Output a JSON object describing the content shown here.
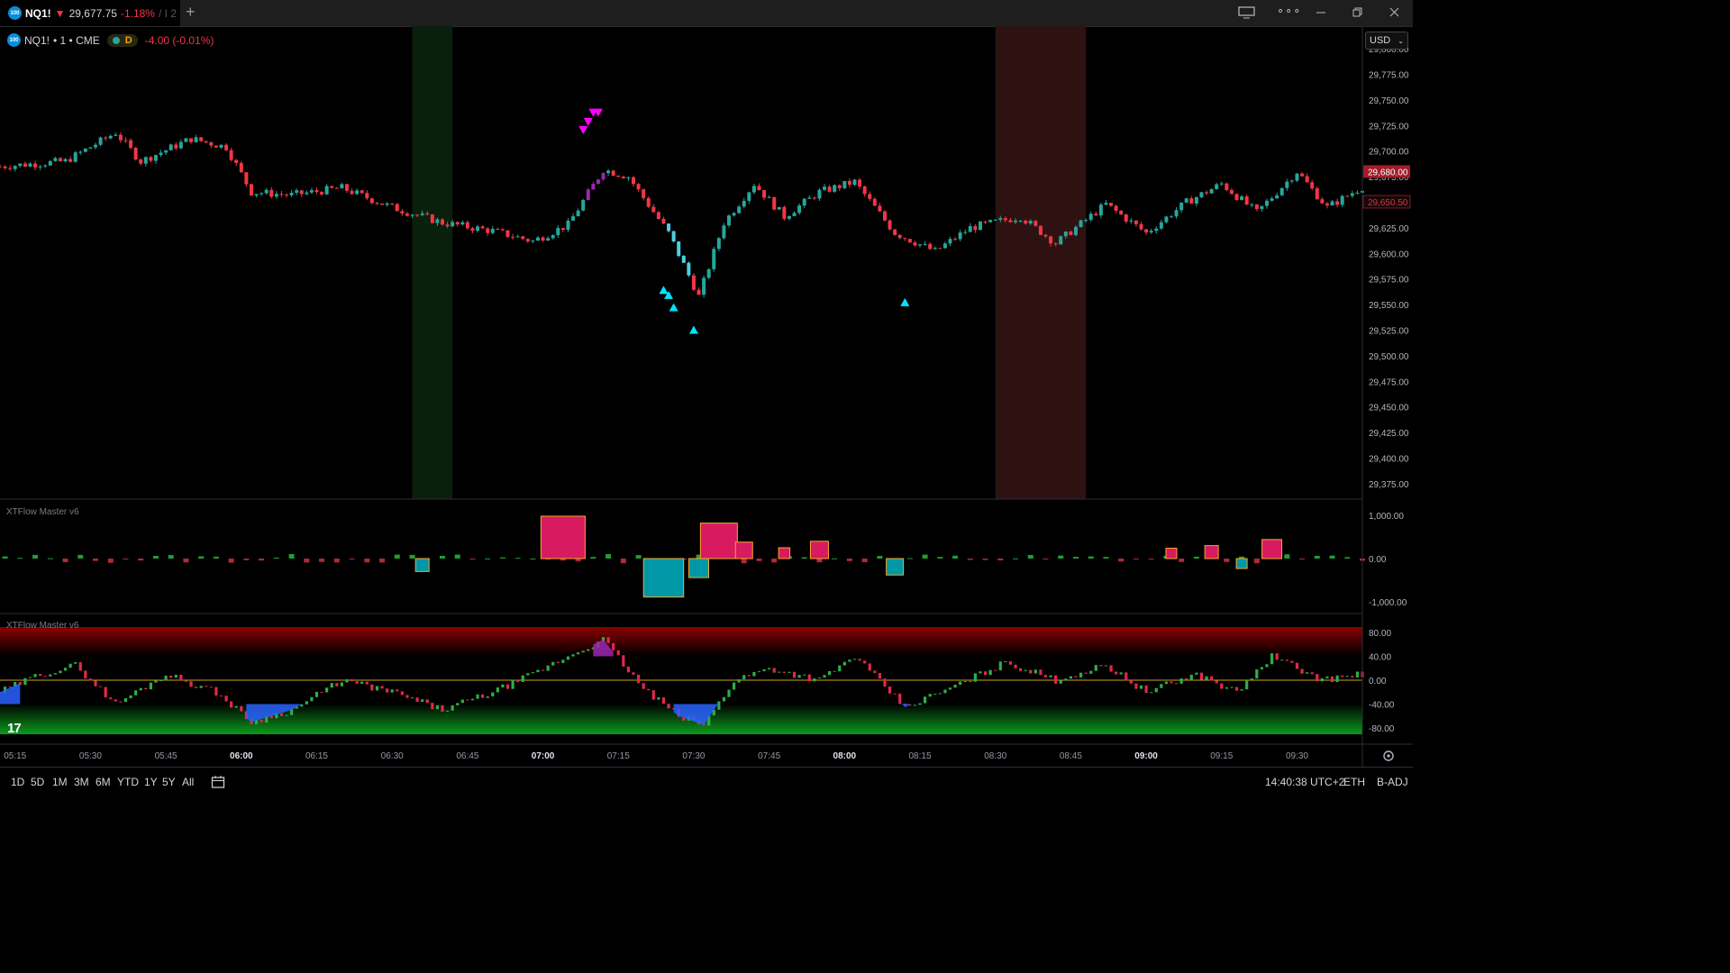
{
  "tab": {
    "symbol": "NQ1!",
    "arrow": "▼",
    "price": "29,677.75",
    "change": "-1.18%",
    "extra": "/ I 2"
  },
  "legend": {
    "symbol": "NQ1!",
    "interval": "• 1 • CME",
    "pill": "D",
    "change": "-4.00 (-0.01%)"
  },
  "currency": "USD",
  "logo_text": "100",
  "icons": [
    "monitor-icon",
    "more-icon",
    "minimize-icon",
    "maximize-icon",
    "close-icon",
    "calendar-icon",
    "settings-icon"
  ],
  "colors": {
    "up": "#26a69a",
    "down": "#f23645",
    "accent": "#d81b60",
    "cyan": "#00bcd4"
  },
  "price_axis": {
    "ticks": [
      "29,800.00",
      "29,775.00",
      "29,750.00",
      "29,725.00",
      "29,700.00",
      "29,675.00",
      "29,650.00",
      "29,625.00",
      "29,600.00",
      "29,575.00",
      "29,550.00",
      "29,525.00",
      "29,500.00",
      "29,475.00",
      "29,450.00",
      "29,425.00",
      "29,400.00",
      "29,375.00"
    ],
    "current_label": "29,680.00",
    "secondary_label": "29,650.50"
  },
  "panes": {
    "hist_label": "XTFlow Master v6",
    "hist_ticks": [
      "1,000.00",
      "0.00",
      "-1,000.00"
    ],
    "osc_label": "XTFlow Master v6",
    "osc_ticks": [
      "80.00",
      "40.00",
      "0.00",
      "-40.00",
      "-80.00"
    ]
  },
  "time_axis": [
    {
      "label": "05:15",
      "bold": false
    },
    {
      "label": "05:30",
      "bold": false
    },
    {
      "label": "05:45",
      "bold": false
    },
    {
      "label": "06:00",
      "bold": true
    },
    {
      "label": "06:15",
      "bold": false
    },
    {
      "label": "06:30",
      "bold": false
    },
    {
      "label": "06:45",
      "bold": false
    },
    {
      "label": "07:00",
      "bold": true
    },
    {
      "label": "07:15",
      "bold": false
    },
    {
      "label": "07:30",
      "bold": false
    },
    {
      "label": "07:45",
      "bold": false
    },
    {
      "label": "08:00",
      "bold": true
    },
    {
      "label": "08:15",
      "bold": false
    },
    {
      "label": "08:30",
      "bold": false
    },
    {
      "label": "08:45",
      "bold": false
    },
    {
      "label": "09:00",
      "bold": true
    },
    {
      "label": "09:15",
      "bold": false
    },
    {
      "label": "09:30",
      "bold": false
    }
  ],
  "ranges": [
    "1D",
    "5D",
    "1M",
    "3M",
    "6M",
    "YTD",
    "1Y",
    "5Y",
    "All"
  ],
  "status": {
    "clock": "14:40:38 UTC+2",
    "session": "ETH",
    "adj": "B-ADJ"
  },
  "chart_data": {
    "type": "candlestick",
    "x_range": [
      "05:12",
      "09:43"
    ],
    "y_range": [
      29360,
      29815
    ],
    "price_path": [
      [
        "05:12",
        29685
      ],
      [
        "05:25",
        29690
      ],
      [
        "05:35",
        29718
      ],
      [
        "05:40",
        29690
      ],
      [
        "05:50",
        29712
      ],
      [
        "05:57",
        29704
      ],
      [
        "06:02",
        29660
      ],
      [
        "06:10",
        29657
      ],
      [
        "06:20",
        29664
      ],
      [
        "06:30",
        29645
      ],
      [
        "06:40",
        29630
      ],
      [
        "06:50",
        29622
      ],
      [
        "06:58",
        29612
      ],
      [
        "07:05",
        29628
      ],
      [
        "07:12",
        29682
      ],
      [
        "07:17",
        29675
      ],
      [
        "07:25",
        29620
      ],
      [
        "07:31",
        29558
      ],
      [
        "07:36",
        29630
      ],
      [
        "07:42",
        29668
      ],
      [
        "07:48",
        29636
      ],
      [
        "07:55",
        29660
      ],
      [
        "08:02",
        29670
      ],
      [
        "08:10",
        29620
      ],
      [
        "08:18",
        29602
      ],
      [
        "08:25",
        29625
      ],
      [
        "08:35",
        29636
      ],
      [
        "08:42",
        29610
      ],
      [
        "08:52",
        29648
      ],
      [
        "09:00",
        29620
      ],
      [
        "09:08",
        29650
      ],
      [
        "09:15",
        29668
      ],
      [
        "09:22",
        29640
      ],
      [
        "09:30",
        29680
      ],
      [
        "09:36",
        29645
      ],
      [
        "09:43",
        29665
      ]
    ],
    "shaded_zones": [
      {
        "from": "06:34",
        "to": "06:42",
        "color": "green"
      },
      {
        "from": "08:30",
        "to": "08:48",
        "color": "red"
      }
    ],
    "sell_signals": [
      [
        "07:08",
        29720
      ],
      [
        "07:09",
        29728
      ],
      [
        "07:10",
        29737
      ],
      [
        "07:11",
        29737
      ]
    ],
    "buy_signals": [
      [
        "07:24",
        29564
      ],
      [
        "07:25",
        29559
      ],
      [
        "07:26",
        29547
      ],
      [
        "07:30",
        29525
      ],
      [
        "08:12",
        29552
      ]
    ],
    "histogram_blocks": [
      {
        "time": "07:04",
        "value": 980,
        "sign": "up"
      },
      {
        "time": "07:24",
        "value": -890,
        "sign": "down"
      },
      {
        "time": "07:35",
        "value": 820,
        "sign": "up"
      },
      {
        "time": "07:40",
        "value": 380,
        "sign": "up"
      },
      {
        "time": "07:48",
        "value": 250,
        "sign": "up"
      },
      {
        "time": "07:55",
        "value": 400,
        "sign": "up"
      },
      {
        "time": "08:10",
        "value": -380,
        "sign": "down"
      },
      {
        "time": "06:36",
        "value": -300,
        "sign": "down"
      },
      {
        "time": "07:31",
        "value": -440,
        "sign": "down"
      },
      {
        "time": "09:05",
        "value": 240,
        "sign": "up"
      },
      {
        "time": "09:13",
        "value": 300,
        "sign": "up"
      },
      {
        "time": "09:25",
        "value": 440,
        "sign": "up"
      },
      {
        "time": "09:19",
        "value": -230,
        "sign": "down"
      }
    ],
    "oscillator_path": [
      [
        "05:12",
        -20
      ],
      [
        "05:20",
        10
      ],
      [
        "05:27",
        25
      ],
      [
        "05:35",
        -40
      ],
      [
        "05:45",
        10
      ],
      [
        "05:55",
        -20
      ],
      [
        "06:02",
        -70
      ],
      [
        "06:10",
        -50
      ],
      [
        "06:20",
        0
      ],
      [
        "06:30",
        -20
      ],
      [
        "06:40",
        -50
      ],
      [
        "06:50",
        -20
      ],
      [
        "06:58",
        10
      ],
      [
        "07:05",
        40
      ],
      [
        "07:12",
        68
      ],
      [
        "07:20",
        -15
      ],
      [
        "07:27",
        -60
      ],
      [
        "07:32",
        -75
      ],
      [
        "07:38",
        0
      ],
      [
        "07:45",
        20
      ],
      [
        "07:55",
        0
      ],
      [
        "08:02",
        40
      ],
      [
        "08:12",
        -45
      ],
      [
        "08:22",
        -10
      ],
      [
        "08:32",
        30
      ],
      [
        "08:42",
        0
      ],
      [
        "08:52",
        25
      ],
      [
        "09:00",
        -20
      ],
      [
        "09:10",
        10
      ],
      [
        "09:18",
        -20
      ],
      [
        "09:25",
        40
      ],
      [
        "09:35",
        0
      ],
      [
        "09:43",
        10
      ]
    ]
  }
}
